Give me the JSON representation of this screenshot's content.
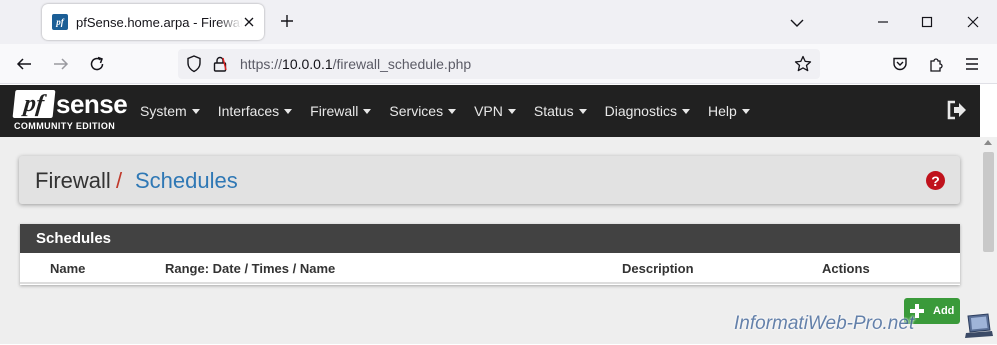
{
  "browser": {
    "tab_title": "pfSense.home.arpa - Firewall: Schedules",
    "favicon_text": "pf",
    "url_prefix": "https://",
    "url_host": "10.0.0.1",
    "url_path": "/firewall_schedule.php",
    "icons": {
      "back": "back-arrow-icon",
      "forward": "forward-arrow-icon",
      "reload": "reload-icon",
      "shield": "tracking-protection-icon",
      "lock": "lock-icon",
      "star": "bookmark-star-icon",
      "pocket": "pocket-icon",
      "extensions": "extensions-icon",
      "menu": "hamburger-menu-icon"
    }
  },
  "pfsense": {
    "logo_pf": "pf",
    "logo_sense": "sense",
    "logo_edition": "COMMUNITY EDITION",
    "menu": [
      "System",
      "Interfaces",
      "Firewall",
      "Services",
      "VPN",
      "Status",
      "Diagnostics",
      "Help"
    ]
  },
  "breadcrumb": {
    "section": "Firewall",
    "separator": "/",
    "page": "Schedules",
    "help_icon": "?"
  },
  "panel": {
    "heading": "Schedules",
    "columns": [
      "Name",
      "Range: Date / Times / Name",
      "Description",
      "Actions"
    ]
  },
  "actions": {
    "add_label": "Add"
  },
  "watermark": "InformatiWeb-Pro.net",
  "colors": {
    "header_bg": "#212121",
    "panel_heading_bg": "#424242",
    "link_blue": "#2f78b5",
    "separator_red": "#c0392b",
    "add_green": "#3a9a3a",
    "help_red": "#c0121c"
  }
}
